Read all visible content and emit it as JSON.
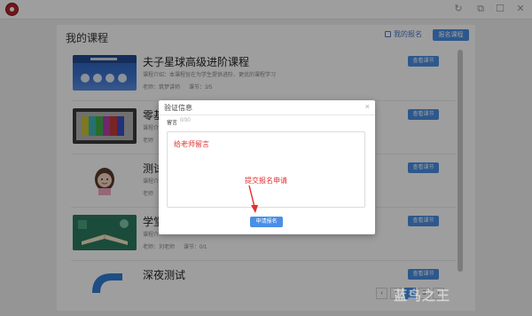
{
  "window": {
    "refresh_icon": "↻",
    "restore_icon": "⧉",
    "minimize_icon": "—",
    "maximize_icon": "☐",
    "close_icon": "✕"
  },
  "panel": {
    "title": "我的课程",
    "my_signup_label": "我的报名",
    "signup_course_button": "报名课程"
  },
  "courses": [
    {
      "title": "夫子星球高级进阶课程",
      "desc": "课程介绍：本课程旨在为学生提供进阶、更优的课程学习",
      "teacher": "老师：筑梦讲师",
      "lessons": "课节：3/5",
      "button": "查看课节"
    },
    {
      "title": "零基础",
      "desc": "课程介绍",
      "teacher": "老师",
      "lessons": "",
      "button": "查看课节"
    },
    {
      "title": "测试",
      "desc": "课程介",
      "teacher": "老师",
      "lessons": "",
      "button": "查看课节"
    },
    {
      "title": "学堂",
      "desc": "课程介",
      "teacher": "老师：刘老师",
      "lessons": "课节：0/1",
      "button": "查看课节"
    },
    {
      "title": "深夜测试",
      "desc": "",
      "teacher": "",
      "lessons": "",
      "button": "查看课节"
    }
  ],
  "pagination": {
    "prev": "‹",
    "pages": [
      "1",
      "2",
      "3"
    ],
    "active_page": "2",
    "next": "›"
  },
  "dialog": {
    "title": "验证信息",
    "close": "×",
    "field_label": "留言",
    "counter": "0/30",
    "message_placeholder": "给老师留言",
    "annotation": "提交报名申请",
    "submit_button": "申请报名"
  },
  "watermark": "蓝鸟之王",
  "colors": {
    "accent": "#4a8ee6",
    "annotation_red": "#e03030"
  }
}
